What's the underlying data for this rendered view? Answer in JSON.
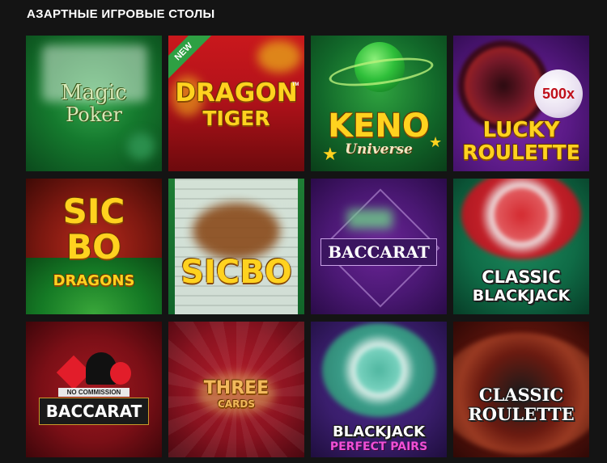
{
  "section": {
    "title": "АЗАРТНЫЕ ИГРОВЫЕ СТОЛЫ"
  },
  "tiles": [
    {
      "lines": [
        "Magic",
        "Poker"
      ]
    },
    {
      "badge": "NEW",
      "lines": [
        "DRAGON",
        "TIGER"
      ],
      "tm": "TM"
    },
    {
      "lines": [
        "KENO",
        "Universe"
      ]
    },
    {
      "badge": "500x",
      "lines": [
        "LUCKY",
        "ROULETTE"
      ]
    },
    {
      "lines": [
        "SIC",
        "BO",
        "DRAGONS"
      ]
    },
    {
      "lines": [
        "SICBO"
      ]
    },
    {
      "lines": [
        "BACCARAT"
      ]
    },
    {
      "lines": [
        "CLASSIC",
        "BLACKJACK"
      ]
    },
    {
      "subtitle": "NO COMMISSION",
      "lines": [
        "BACCARAT"
      ]
    },
    {
      "lines": [
        "THREE",
        "CARDS"
      ]
    },
    {
      "lines": [
        "BLACKJACK",
        "PERFECT PAIRS"
      ]
    },
    {
      "lines": [
        "CLASSIC",
        "ROULETTE"
      ]
    }
  ]
}
